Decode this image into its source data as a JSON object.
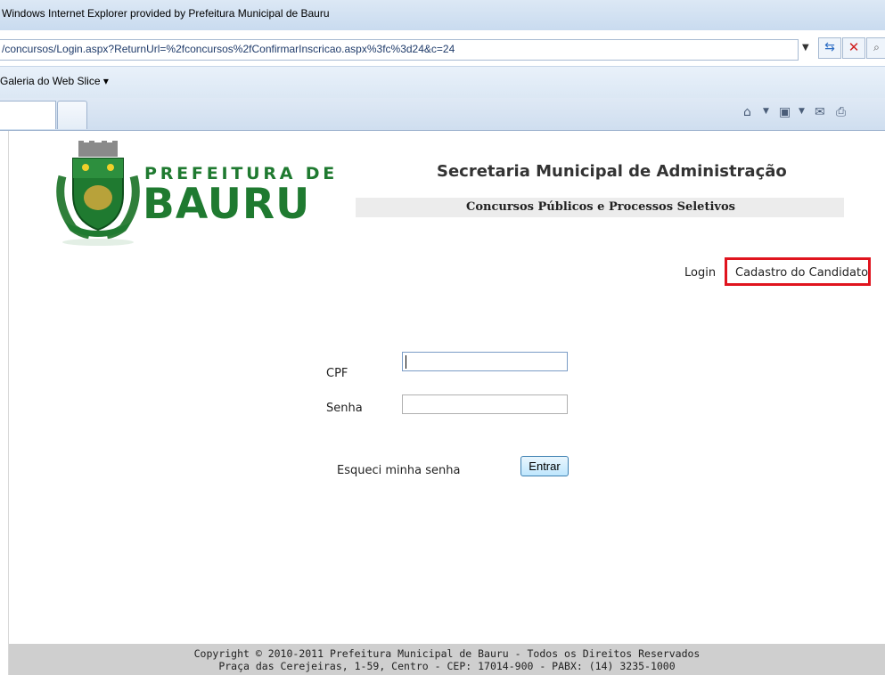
{
  "browser": {
    "title": "Windows Internet Explorer provided by Prefeitura Municipal de Bauru",
    "address": "/concursos/Login.aspx?ReturnUrl=%2fconcursos%2fConfirmarInscricao.aspx%3fc%3d24&c=24",
    "favorites_label": "Galeria do Web Slice ▾",
    "icons": {
      "refresh": "refresh-icon",
      "stop": "stop-icon",
      "home": "home-icon",
      "feeds": "feeds-icon",
      "mail": "mail-icon",
      "print": "print-icon"
    }
  },
  "header": {
    "logo_top": "PREFEITURA DE",
    "logo_bottom": "BAURU",
    "title": "Secretaria Municipal de Administração",
    "subtitle": "Concursos Públicos e Processos Seletivos"
  },
  "nav": {
    "login": "Login",
    "cadastro": "Cadastro do Candidato"
  },
  "form": {
    "cpf_label": "CPF",
    "cpf_value": "",
    "senha_label": "Senha",
    "senha_value": "",
    "forgot": "Esqueci minha senha",
    "submit": "Entrar"
  },
  "footer": {
    "line1": "Copyright © 2010-2011 Prefeitura Municipal de Bauru - Todos os Direitos Reservados",
    "line2": "Praça das Cerejeiras, 1-59, Centro - CEP: 17014-900 - PABX: (14) 3235-1000"
  },
  "colors": {
    "brand_green": "#1f7a30",
    "highlight_red": "#e0141e",
    "footer_gray": "#cfcfcf"
  }
}
